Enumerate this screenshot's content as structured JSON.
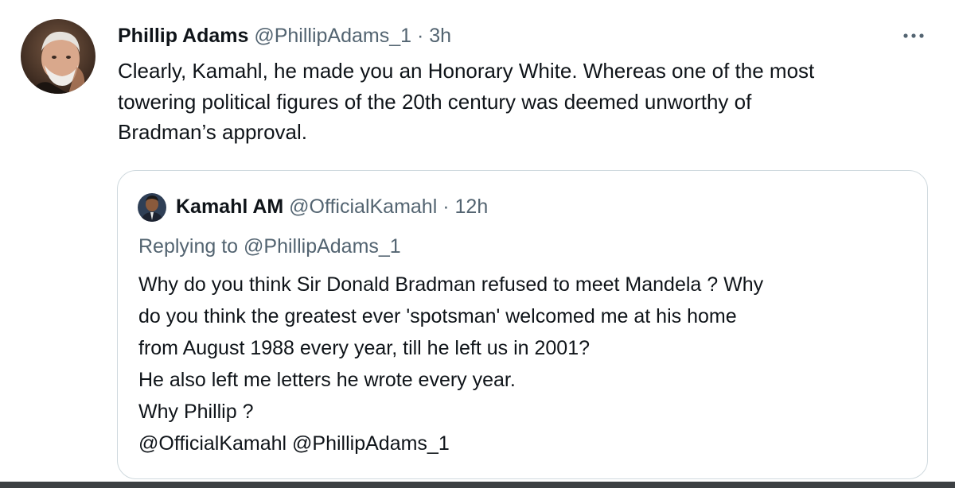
{
  "tweet": {
    "author": {
      "display_name": "Phillip Adams",
      "handle": "@PhillipAdams_1",
      "avatar_icon": "user-avatar-photo"
    },
    "separator": "·",
    "time": "3h",
    "more_label": "···",
    "text": "Clearly, Kamahl, he made you an Honorary White. Whereas one of the most\ntowering political figures of the 20th century was deemed unworthy of\nBradman’s approval."
  },
  "quoted_tweet": {
    "author": {
      "display_name": "Kamahl AM",
      "handle": "@OfficialKamahl",
      "avatar_icon": "user-avatar-photo"
    },
    "separator": "·",
    "time": "12h",
    "replying_to": "Replying to @PhillipAdams_1",
    "text": "Why do you think Sir Donald Bradman refused to meet Mandela ? Why\ndo you think the greatest ever 'spotsman' welcomed me at his home\nfrom August 1988 every year, till he left us in 2001?\nHe also left me letters he wrote every year.\nWhy Phillip ?\n@OfficialKamahl @PhillipAdams_1"
  },
  "colors": {
    "text_primary": "#0f1419",
    "text_secondary": "#536471",
    "card_border": "#cfd9de"
  }
}
